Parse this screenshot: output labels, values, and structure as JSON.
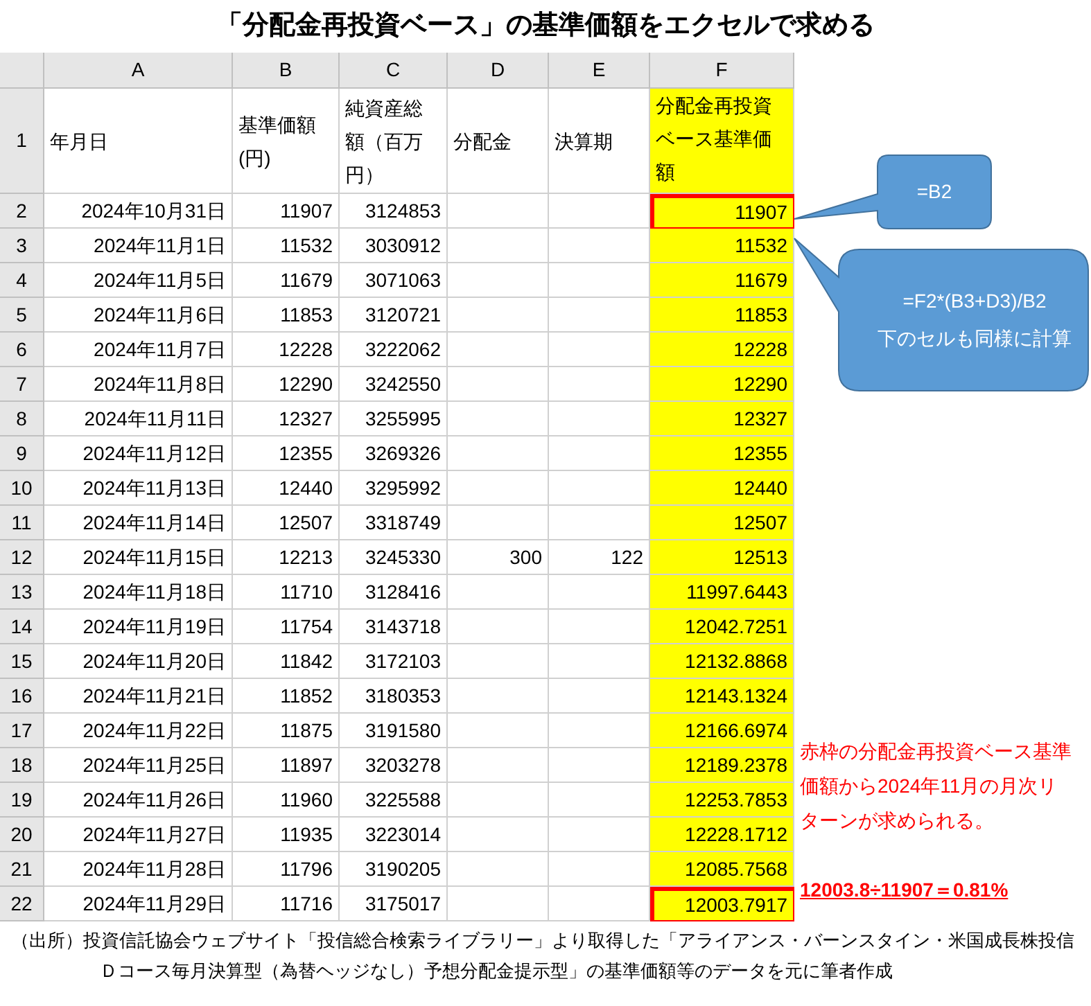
{
  "title": "「分配金再投資ベース」の基準価額をエクセルで求める",
  "columns": [
    "A",
    "B",
    "C",
    "D",
    "E",
    "F"
  ],
  "header_row": {
    "row": "1",
    "cells": [
      "年月日",
      "基準価額(円)",
      "純資産総額（百万円）",
      "分配金",
      "決算期",
      "分配金再投資ベース基準価額"
    ]
  },
  "rows": [
    {
      "row": "2",
      "date": "2024年10月31日",
      "nav": "11907",
      "assets": "3124853",
      "reinvested_nav": "11907",
      "red_frame": true
    },
    {
      "row": "3",
      "date": "2024年11月1日",
      "nav": "11532",
      "assets": "3030912",
      "reinvested_nav": "11532",
      "red_frame": false
    },
    {
      "row": "4",
      "date": "2024年11月5日",
      "nav": "11679",
      "assets": "3071063",
      "reinvested_nav": "11679",
      "red_frame": false
    },
    {
      "row": "5",
      "date": "2024年11月6日",
      "nav": "11853",
      "assets": "3120721",
      "reinvested_nav": "11853",
      "red_frame": false
    },
    {
      "row": "6",
      "date": "2024年11月7日",
      "nav": "12228",
      "assets": "3222062",
      "reinvested_nav": "12228",
      "red_frame": false
    },
    {
      "row": "7",
      "date": "2024年11月8日",
      "nav": "12290",
      "assets": "3242550",
      "reinvested_nav": "12290",
      "red_frame": false
    },
    {
      "row": "8",
      "date": "2024年11月11日",
      "nav": "12327",
      "assets": "3255995",
      "reinvested_nav": "12327",
      "red_frame": false
    },
    {
      "row": "9",
      "date": "2024年11月12日",
      "nav": "12355",
      "assets": "3269326",
      "reinvested_nav": "12355",
      "red_frame": false
    },
    {
      "row": "10",
      "date": "2024年11月13日",
      "nav": "12440",
      "assets": "3295992",
      "reinvested_nav": "12440",
      "red_frame": false
    },
    {
      "row": "11",
      "date": "2024年11月14日",
      "nav": "12507",
      "assets": "3318749",
      "reinvested_nav": "12507",
      "red_frame": false
    },
    {
      "row": "12",
      "date": "2024年11月15日",
      "nav": "12213",
      "assets": "3245330",
      "dividend": "300",
      "settlement": "122",
      "reinvested_nav": "12513",
      "red_frame": false
    },
    {
      "row": "13",
      "date": "2024年11月18日",
      "nav": "11710",
      "assets": "3128416",
      "reinvested_nav": "11997.6443",
      "red_frame": false
    },
    {
      "row": "14",
      "date": "2024年11月19日",
      "nav": "11754",
      "assets": "3143718",
      "reinvested_nav": "12042.7251",
      "red_frame": false
    },
    {
      "row": "15",
      "date": "2024年11月20日",
      "nav": "11842",
      "assets": "3172103",
      "reinvested_nav": "12132.8868",
      "red_frame": false
    },
    {
      "row": "16",
      "date": "2024年11月21日",
      "nav": "11852",
      "assets": "3180353",
      "reinvested_nav": "12143.1324",
      "red_frame": false
    },
    {
      "row": "17",
      "date": "2024年11月22日",
      "nav": "11875",
      "assets": "3191580",
      "reinvested_nav": "12166.6974",
      "red_frame": false
    },
    {
      "row": "18",
      "date": "2024年11月25日",
      "nav": "11897",
      "assets": "3203278",
      "reinvested_nav": "12189.2378",
      "red_frame": false
    },
    {
      "row": "19",
      "date": "2024年11月26日",
      "nav": "11960",
      "assets": "3225588",
      "reinvested_nav": "12253.7853",
      "red_frame": false
    },
    {
      "row": "20",
      "date": "2024年11月27日",
      "nav": "11935",
      "assets": "3223014",
      "reinvested_nav": "12228.1712",
      "red_frame": false
    },
    {
      "row": "21",
      "date": "2024年11月28日",
      "nav": "11796",
      "assets": "3190205",
      "reinvested_nav": "12085.7568",
      "red_frame": false
    },
    {
      "row": "22",
      "date": "2024年11月29日",
      "nav": "11716",
      "assets": "3175017",
      "reinvested_nav": "12003.7917",
      "red_frame": true
    }
  ],
  "callouts": [
    {
      "lines": [
        "=B2"
      ]
    },
    {
      "lines": [
        "=F2*(B3+D3)/B2",
        "下のセルも同様に計算"
      ]
    }
  ],
  "note": "赤枠の分配金再投資ベース基準価額から2024年11月の月次リターンが求められる。",
  "result": "12003.8÷11907＝0.81%",
  "source_lines": [
    "（出所）投資信託協会ウェブサイト「投信総合検索ライブラリー」より取得した「アライアンス・バーンスタイン・米国成長株投信",
    "Ｄコース毎月決算型（為替ヘッジなし）予想分配金提示型」の基準価額等のデータを元に筆者作成"
  ]
}
